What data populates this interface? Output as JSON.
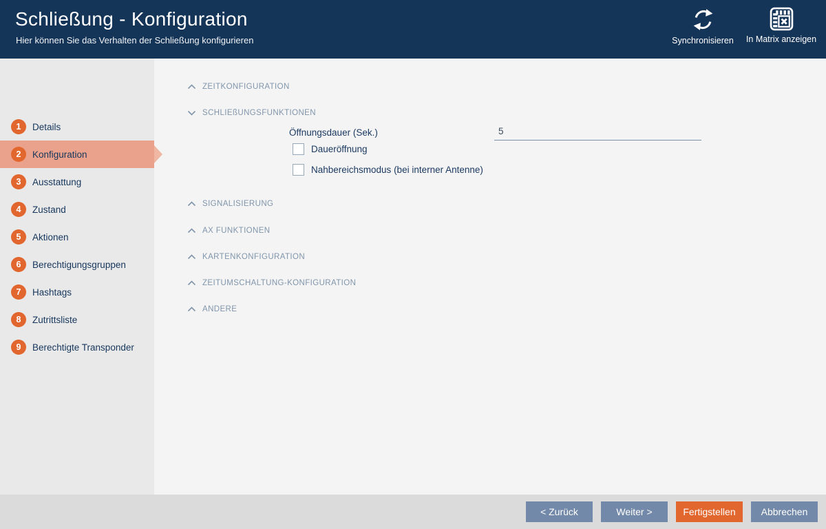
{
  "header": {
    "title": "Schließung - Konfiguration",
    "subtitle": "Hier können Sie das Verhalten der Schließung konfigurieren",
    "actions": {
      "sync": {
        "label": "Synchronisieren",
        "icon": "sync-icon"
      },
      "matrix": {
        "label": "In Matrix anzeigen",
        "icon": "matrix-grid-x-icon"
      }
    }
  },
  "sidebar": {
    "items": [
      {
        "number": "1",
        "label": "Details",
        "active": false
      },
      {
        "number": "2",
        "label": "Konfiguration",
        "active": true
      },
      {
        "number": "3",
        "label": "Ausstattung",
        "active": false
      },
      {
        "number": "4",
        "label": "Zustand",
        "active": false
      },
      {
        "number": "5",
        "label": "Aktionen",
        "active": false
      },
      {
        "number": "6",
        "label": "Berechtigungsgruppen",
        "active": false
      },
      {
        "number": "7",
        "label": "Hashtags",
        "active": false
      },
      {
        "number": "8",
        "label": "Zutrittsliste",
        "active": false
      },
      {
        "number": "9",
        "label": "Berechtigte Transponder",
        "active": false
      }
    ]
  },
  "main": {
    "sections": [
      {
        "label": "ZEITKONFIGURATION",
        "state": "collapsed"
      },
      {
        "label": "SCHLIEßUNGSFUNKTIONEN",
        "state": "expanded"
      },
      {
        "label": "SIGNALISIERUNG",
        "state": "collapsed"
      },
      {
        "label": "AX FUNKTIONEN",
        "state": "collapsed"
      },
      {
        "label": "KARTENKONFIGURATION",
        "state": "collapsed"
      },
      {
        "label": "ZEITUMSCHALTUNG-KONFIGURATION",
        "state": "collapsed"
      },
      {
        "label": "ANDERE",
        "state": "collapsed"
      }
    ],
    "form": {
      "opening_duration_label": "Öffnungsdauer (Sek.)",
      "opening_duration_value": "5",
      "checkbox_permanent_open": {
        "label": "Daueröffnung",
        "checked": false
      },
      "checkbox_near_field": {
        "label": "Nahbereichsmodus (bei interner Antenne)",
        "checked": false
      }
    }
  },
  "footer": {
    "back": "< Zurück",
    "next": "Weiter >",
    "finish": "Fertigstellen",
    "cancel": "Abbrechen"
  },
  "colors": {
    "header_navy": "#143458",
    "accent_orange": "#e2672f",
    "active_salmon": "#eaa28c",
    "sidebar_gray": "#e9e9e9",
    "content_gray": "#f4f4f4",
    "footer_gray": "#dbdbdb",
    "section_text": "#8095ab",
    "label_navy": "#1c3a61",
    "button_blue_gray": "#7389a9"
  }
}
